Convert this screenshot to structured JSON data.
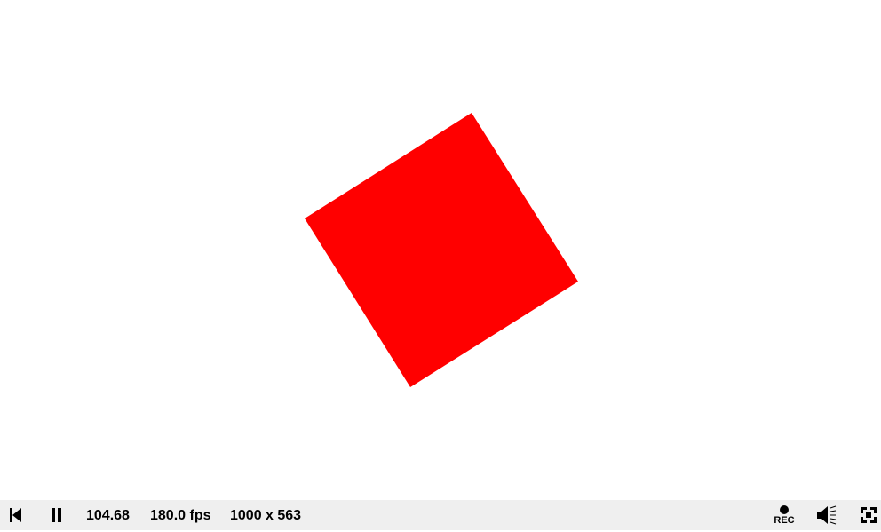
{
  "canvas": {
    "background": "#ffffff",
    "shape": {
      "kind": "square",
      "color": "#ff0000"
    }
  },
  "controls": {
    "background": "#efefef",
    "time": "104.68",
    "fps": "180.0 fps",
    "resolution": "1000 x 563",
    "rec_label": "REC",
    "icons": {
      "rewind": "skip-to-start-icon",
      "pause": "pause-icon",
      "record": "record-icon",
      "volume": "volume-icon",
      "fullscreen": "fullscreen-icon"
    }
  }
}
